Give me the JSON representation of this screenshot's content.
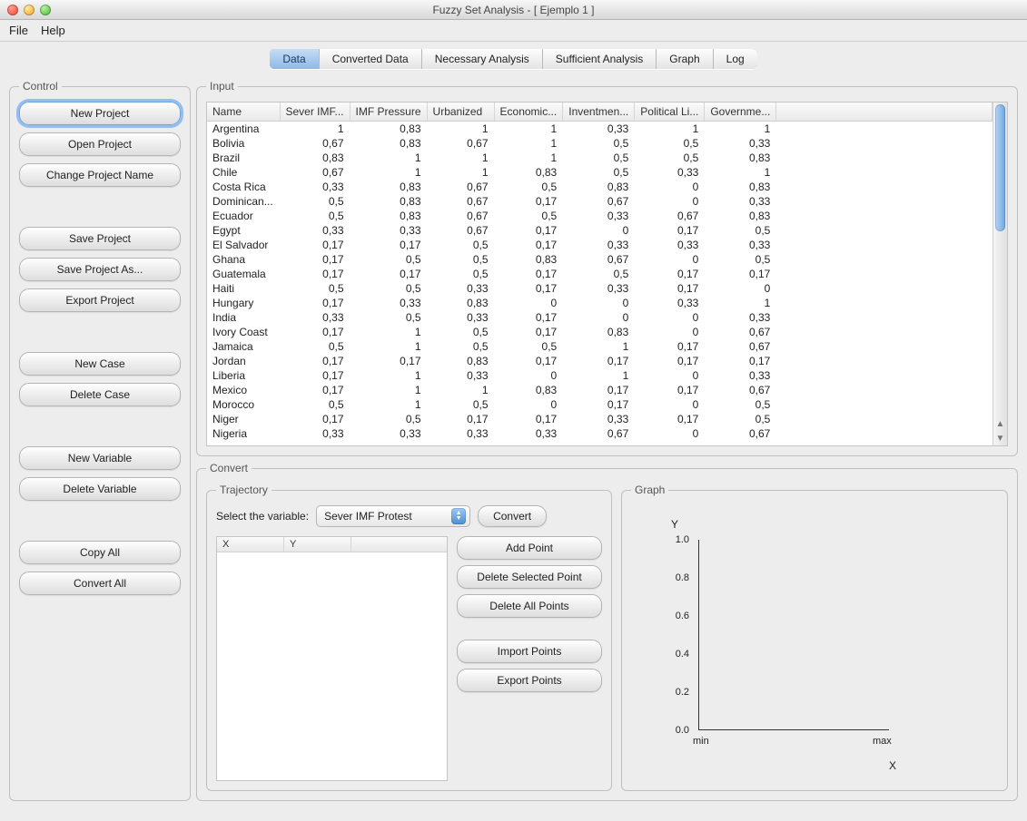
{
  "window": {
    "title": "Fuzzy Set Analysis - [ Ejemplo 1 ]"
  },
  "menubar": {
    "file": "File",
    "help": "Help"
  },
  "tabs": {
    "data": "Data",
    "converted": "Converted Data",
    "necessary": "Necessary Analysis",
    "sufficient": "Sufficient Analysis",
    "graph": "Graph",
    "log": "Log"
  },
  "control": {
    "legend": "Control",
    "new_project": "New Project",
    "open_project": "Open Project",
    "change_name": "Change Project Name",
    "save_project": "Save Project",
    "save_as": "Save Project As...",
    "export_project": "Export Project",
    "new_case": "New Case",
    "delete_case": "Delete Case",
    "new_variable": "New Variable",
    "delete_variable": "Delete Variable",
    "copy_all": "Copy All",
    "convert_all": "Convert All"
  },
  "input": {
    "legend": "Input",
    "columns": [
      "Name",
      "Sever IMF...",
      "IMF Pressure",
      "Urbanized",
      "Economic...",
      "Inventmen...",
      "Political Li...",
      "Governme..."
    ],
    "rows": [
      [
        "Argentina",
        "1",
        "0,83",
        "1",
        "1",
        "0,33",
        "1",
        "1"
      ],
      [
        "Bolivia",
        "0,67",
        "0,83",
        "0,67",
        "1",
        "0,5",
        "0,5",
        "0,33"
      ],
      [
        "Brazil",
        "0,83",
        "1",
        "1",
        "1",
        "0,5",
        "0,5",
        "0,83"
      ],
      [
        "Chile",
        "0,67",
        "1",
        "1",
        "0,83",
        "0,5",
        "0,33",
        "1"
      ],
      [
        "Costa Rica",
        "0,33",
        "0,83",
        "0,67",
        "0,5",
        "0,83",
        "0",
        "0,83"
      ],
      [
        "Dominican...",
        "0,5",
        "0,83",
        "0,67",
        "0,17",
        "0,67",
        "0",
        "0,33"
      ],
      [
        "Ecuador",
        "0,5",
        "0,83",
        "0,67",
        "0,5",
        "0,33",
        "0,67",
        "0,83"
      ],
      [
        "Egypt",
        "0,33",
        "0,33",
        "0,67",
        "0,17",
        "0",
        "0,17",
        "0,5"
      ],
      [
        "El Salvador",
        "0,17",
        "0,17",
        "0,5",
        "0,17",
        "0,33",
        "0,33",
        "0,33"
      ],
      [
        "Ghana",
        "0,17",
        "0,5",
        "0,5",
        "0,83",
        "0,67",
        "0",
        "0,5"
      ],
      [
        "Guatemala",
        "0,17",
        "0,17",
        "0,5",
        "0,17",
        "0,5",
        "0,17",
        "0,17"
      ],
      [
        "Haiti",
        "0,5",
        "0,5",
        "0,33",
        "0,17",
        "0,33",
        "0,17",
        "0"
      ],
      [
        "Hungary",
        "0,17",
        "0,33",
        "0,83",
        "0",
        "0",
        "0,33",
        "1"
      ],
      [
        "India",
        "0,33",
        "0,5",
        "0,33",
        "0,17",
        "0",
        "0",
        "0,33"
      ],
      [
        "Ivory Coast",
        "0,17",
        "1",
        "0,5",
        "0,17",
        "0,83",
        "0",
        "0,67"
      ],
      [
        "Jamaica",
        "0,5",
        "1",
        "0,5",
        "0,5",
        "1",
        "0,17",
        "0,67"
      ],
      [
        "Jordan",
        "0,17",
        "0,17",
        "0,83",
        "0,17",
        "0,17",
        "0,17",
        "0,17"
      ],
      [
        "Liberia",
        "0,17",
        "1",
        "0,33",
        "0",
        "1",
        "0",
        "0,33"
      ],
      [
        "Mexico",
        "0,17",
        "1",
        "1",
        "0,83",
        "0,17",
        "0,17",
        "0,67"
      ],
      [
        "Morocco",
        "0,5",
        "1",
        "0,5",
        "0",
        "0,17",
        "0",
        "0,5"
      ],
      [
        "Niger",
        "0,17",
        "0,5",
        "0,17",
        "0,17",
        "0,33",
        "0,17",
        "0,5"
      ],
      [
        "Nigeria",
        "0,33",
        "0,33",
        "0,33",
        "0,33",
        "0,67",
        "0",
        "0,67"
      ]
    ]
  },
  "convert": {
    "legend": "Convert",
    "trajectory": {
      "legend": "Trajectory",
      "select_label": "Select the variable:",
      "selected_variable": "Sever IMF Protest",
      "convert_btn": "Convert",
      "xy": {
        "x": "X",
        "y": "Y"
      },
      "add_point": "Add Point",
      "delete_selected": "Delete Selected Point",
      "delete_all": "Delete All Points",
      "import_points": "Import Points",
      "export_points": "Export Points"
    },
    "graph": {
      "legend": "Graph"
    }
  },
  "chart_data": {
    "type": "line",
    "title": "",
    "xlabel": "X",
    "ylabel": "Y",
    "x_ticks": [
      "min",
      "max"
    ],
    "y_ticks": [
      "0.0",
      "0.2",
      "0.4",
      "0.6",
      "0.8",
      "1.0"
    ],
    "ylim": [
      0.0,
      1.0
    ],
    "series": []
  }
}
